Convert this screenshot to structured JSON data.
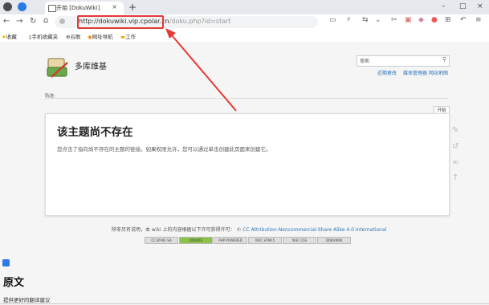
{
  "browser": {
    "tab_title": "开始 [DokuWiki]",
    "tab_close": "×",
    "new_tab": "+",
    "win_min": "–",
    "win_max": "□",
    "win_close": "×",
    "url_host": "http://dokuwiki.vip.cpolar.cn",
    "url_path": "/doku.php?id=start",
    "bookmarks": [
      "收藏",
      "手机收藏夹",
      "谷歌",
      "网址导航",
      "工作"
    ]
  },
  "page": {
    "site_title": "多库维基",
    "search_placeholder": "搜索",
    "search_icon": "search-icon",
    "top_links": [
      "近期更改",
      "媒体管理器",
      "网站地图"
    ],
    "breadcrumb": "轨迹:",
    "start_tab": "开始",
    "heading": "该主题尚不存在",
    "message": "您点击了指向尚不存在的主题的链接。如果权限允许，您可以通过单击创建此页面来创建它。",
    "footer_text": "除非另有说明，本 wiki 上的内容根据以下许可获得许可：",
    "license": "CC Attribution-Noncommercial-Share Alike 4.0 International",
    "badges": [
      "CC BY-NC-SA",
      "DONATE",
      "PHP POWERED",
      "W3C HTML5",
      "W3C CSS",
      "DOKUWIKI"
    ]
  },
  "overlay": {
    "section_title": "原文",
    "feedback": "提供更好的翻译建议"
  },
  "colors": {
    "highlight": "#e53935",
    "link": "#2b73b7"
  }
}
